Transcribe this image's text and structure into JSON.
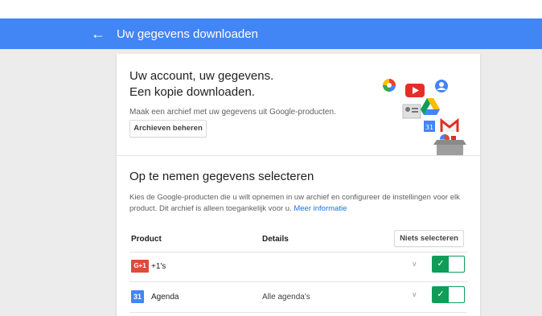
{
  "header": {
    "back_icon": "arrow-back-icon",
    "title": "Uw gegevens downloaden",
    "color": "#4285f4"
  },
  "intro": {
    "headline_line1": "Uw account, uw gegevens.",
    "headline_line2": "Een kopie downloaden.",
    "description": "Maak een archief met uw gegevens uit Google-producten.",
    "archive_button": "Archieven beheren"
  },
  "selection": {
    "title": "Op te nemen gegevens selecteren",
    "description": "Kies de Google-producten die u wilt opnemen in uw archief en configureer de instellingen voor elk product. Dit archief is alleen toegankelijk voor u.",
    "link": "Meer informatie",
    "columns": {
      "product": "Product",
      "details": "Details"
    },
    "deselect_button": "Niets selecteren",
    "rows": [
      {
        "icon": "google-plus-icon",
        "icon_text": "G+1",
        "name": "+1's",
        "details": "",
        "enabled": true
      },
      {
        "icon": "calendar-icon",
        "icon_text": "31",
        "name": "Agenda",
        "details": "Alle agenda's",
        "enabled": true
      }
    ],
    "toggle_color": "#0f9d58"
  }
}
